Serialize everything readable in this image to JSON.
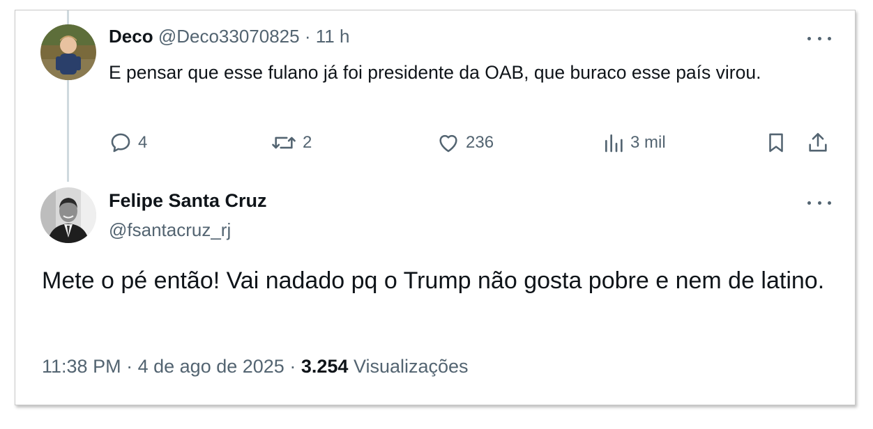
{
  "reply": {
    "name": "Deco",
    "handle": "@Deco33070825",
    "separator": "·",
    "time": "11 h",
    "text": "E pensar que esse fulano já foi presidente da OAB, que buraco esse país virou.",
    "actions": {
      "replies": "4",
      "reposts": "2",
      "likes": "236",
      "views": "3 mil"
    },
    "avatar_icon": "avatar-child-photo",
    "more_icon": "more-horizontal-icon"
  },
  "main": {
    "name": "Felipe Santa Cruz",
    "handle": "@fsantacruz_rj",
    "text": "Mete o pé então! Vai nadado pq o Trump não gosta pobre e nem de latino.",
    "time": "11:38 PM",
    "separator": "·",
    "date": "4 de ago de 2025",
    "views_count": "3.254",
    "views_label": "Visualizações",
    "avatar_icon": "avatar-man-suit-photo"
  },
  "colors": {
    "text": "#0f1419",
    "muted": "#536471",
    "thread_line": "#cfd9de"
  }
}
